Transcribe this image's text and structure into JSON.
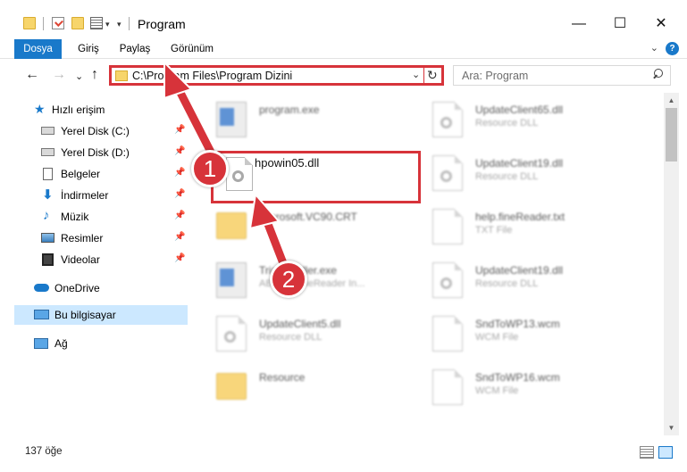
{
  "window": {
    "title": "Program",
    "controls": {
      "minimize": "—",
      "maximize": "☐",
      "close": "✕"
    }
  },
  "ribbon": {
    "tabs": [
      "Dosya",
      "Giriş",
      "Paylaş",
      "Görünüm"
    ],
    "help": "?",
    "expand": "⌄"
  },
  "navigation": {
    "back": "←",
    "forward": "→",
    "recent": "⌄",
    "up": "↑",
    "address": "C:\\Program Files\\Program Dizini",
    "refresh": "↻",
    "search_placeholder": "Ara: Program"
  },
  "sidebar": {
    "items": [
      {
        "label": "Hızlı erişim",
        "icon": "star-icon"
      },
      {
        "label": "Yerel Disk (C:)",
        "icon": "drive-icon",
        "pinned": true
      },
      {
        "label": "Yerel Disk (D:)",
        "icon": "drive-icon",
        "pinned": true
      },
      {
        "label": "Belgeler",
        "icon": "documents-icon",
        "pinned": true
      },
      {
        "label": "İndirmeler",
        "icon": "download-icon",
        "pinned": true
      },
      {
        "label": "Müzik",
        "icon": "music-icon",
        "pinned": true
      },
      {
        "label": "Resimler",
        "icon": "pictures-icon",
        "pinned": true
      },
      {
        "label": "Videolar",
        "icon": "videos-icon",
        "pinned": true
      },
      {
        "label": "OneDrive",
        "icon": "cloud-icon"
      },
      {
        "label": "Bu bilgisayar",
        "icon": "computer-icon",
        "selected": true
      },
      {
        "label": "Ağ",
        "icon": "network-icon"
      }
    ],
    "pin_glyph": "📌"
  },
  "files": {
    "left": [
      {
        "name": "program.exe",
        "type": "",
        "icon": "exe-icon"
      },
      {
        "name": "hpowin05.dll",
        "type": "",
        "icon": "dll-icon",
        "highlighted": true
      },
      {
        "name": "Microsoft.VC90.CRT",
        "type": "",
        "icon": "folder-icon"
      },
      {
        "name": "TrialInstaller.exe",
        "type": "ABBYY FineReader In...",
        "icon": "exe-icon"
      },
      {
        "name": "UpdateClient5.dll",
        "type": "Resource DLL",
        "icon": "dll-icon"
      },
      {
        "name": "Resource",
        "type": "",
        "icon": "folder-icon"
      }
    ],
    "right": [
      {
        "name": "UpdateClient65.dll",
        "type": "Resource DLL",
        "icon": "dll-icon"
      },
      {
        "name": "UpdateClient19.dll",
        "type": "Resource DLL",
        "icon": "dll-icon"
      },
      {
        "name": "help.fineReader.txt",
        "type": "TXT File",
        "icon": "txt-icon"
      },
      {
        "name": "UpdateClient19.dll",
        "type": "Resource DLL",
        "icon": "dll-icon"
      },
      {
        "name": "SndToWP13.wcm",
        "type": "WCM File",
        "icon": "file-icon"
      },
      {
        "name": "SndToWP16.wcm",
        "type": "WCM File",
        "icon": "file-icon"
      }
    ]
  },
  "status": {
    "item_count": "137 öğe"
  },
  "annotations": {
    "badge1": "1",
    "badge2": "2",
    "color": "#d7333a"
  }
}
